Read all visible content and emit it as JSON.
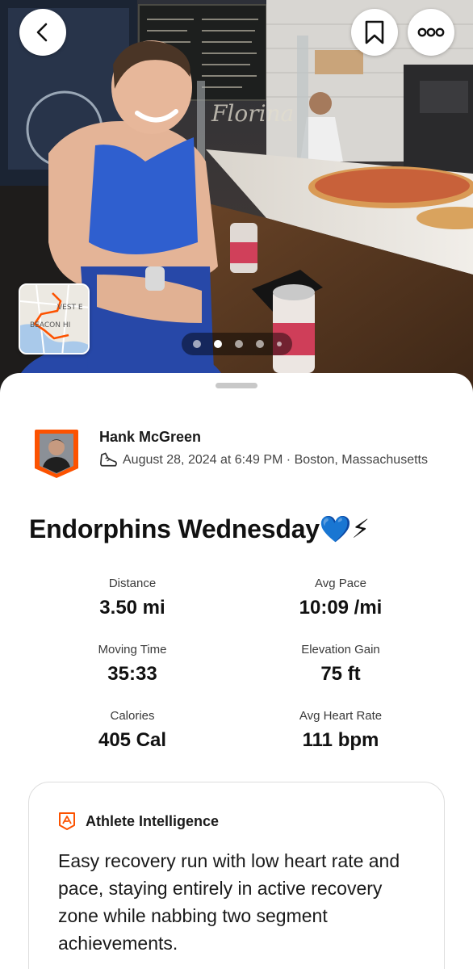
{
  "header": {
    "back_icon": "chevron-left-icon",
    "bookmark_icon": "bookmark-icon",
    "more_icon": "more-horizontal-icon",
    "photo_sign": "Florina",
    "map_labels": [
      "VEST E",
      "BEACON HI"
    ],
    "pager": {
      "count": 5,
      "active_index": 1
    }
  },
  "athlete": {
    "name": "Hank McGreen",
    "activity_icon": "shoe-icon",
    "meta": "August 28, 2024 at 6:49 PM · Boston, Massachusetts"
  },
  "activity": {
    "title": "Endorphins Wednesday💙⚡"
  },
  "stats": {
    "distance": {
      "label": "Distance",
      "value": "3.50 mi"
    },
    "avg_pace": {
      "label": "Avg Pace",
      "value": "10:09 /mi"
    },
    "moving_time": {
      "label": "Moving Time",
      "value": "35:33"
    },
    "elevation_gain": {
      "label": "Elevation Gain",
      "value": "75 ft"
    },
    "calories": {
      "label": "Calories",
      "value": "405 Cal"
    },
    "avg_heart_rate": {
      "label": "Avg Heart Rate",
      "value": "111 bpm"
    }
  },
  "athlete_intelligence": {
    "icon": "athlete-intelligence-icon",
    "title": "Athlete Intelligence",
    "summary": "Easy recovery run with low heart rate and pace, staying entirely in active recovery zone while nabbing two segment achievements."
  },
  "colors": {
    "brand": "#fc5200",
    "heart": "#1e6fff",
    "bolt": "#f2b01e"
  }
}
